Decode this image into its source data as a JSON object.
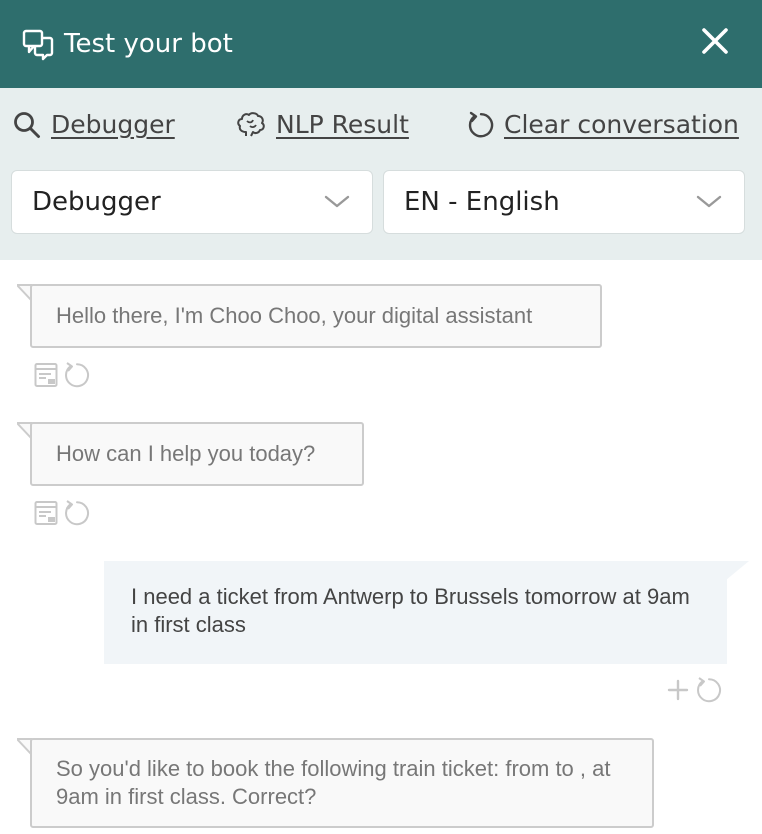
{
  "header": {
    "title": "Test your bot",
    "close_icon": "close-icon",
    "bg_color": "#2e6e6d"
  },
  "toolbar": {
    "debugger_label": "Debugger",
    "nlp_label": "NLP Result",
    "clear_label": "Clear conversation",
    "bg_color": "#e7eeee"
  },
  "selects": {
    "mode_value": "Debugger",
    "language_value": "EN - English"
  },
  "messages": [
    {
      "sender": "bot",
      "text": "Hello there, I'm Choo Choo, your digital assistant"
    },
    {
      "sender": "bot",
      "text": "How can I help you today?"
    },
    {
      "sender": "user",
      "text": "I need a ticket from Antwerp to Brussels tomorrow at 9am in first class"
    },
    {
      "sender": "bot",
      "text": "So you'd like to book the following train ticket: from to , at 9am in first class. Correct?"
    }
  ]
}
